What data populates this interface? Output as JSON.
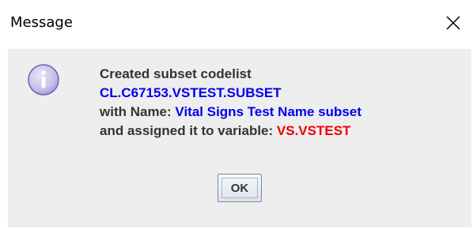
{
  "window": {
    "title": "Message",
    "close_icon": "close-icon"
  },
  "message": {
    "icon": "info-icon",
    "line1": "Created subset codelist",
    "codelist_id": "CL.C67153.VSTEST.SUBSET",
    "name_prefix": "with Name:",
    "name_value": "Vital Signs Test Name subset",
    "assign_prefix": "and assigned it to variable:",
    "variable": "VS.VSTEST"
  },
  "buttons": {
    "ok_label": "OK"
  },
  "colors": {
    "text": "#333333",
    "highlight_blue": "#0000ee",
    "highlight_red": "#ee0000",
    "panel_bg": "#eeeeee"
  }
}
